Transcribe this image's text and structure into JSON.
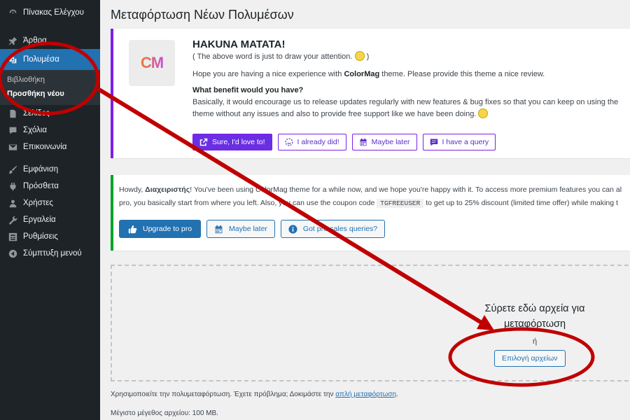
{
  "sidebar": {
    "items": [
      {
        "label": "Πίνακας Ελέγχου",
        "icon": "dashboard-icon"
      },
      {
        "label": "Άρθρα",
        "icon": "pin-icon"
      },
      {
        "label": "Πολυμέσα",
        "icon": "media-icon"
      },
      {
        "label": "Σελίδες",
        "icon": "page-icon"
      },
      {
        "label": "Σχόλια",
        "icon": "comment-icon"
      },
      {
        "label": "Επικοινωνία",
        "icon": "mail-icon"
      },
      {
        "label": "Εμφάνιση",
        "icon": "brush-icon"
      },
      {
        "label": "Πρόσθετα",
        "icon": "plugin-icon"
      },
      {
        "label": "Χρήστες",
        "icon": "users-icon"
      },
      {
        "label": "Εργαλεία",
        "icon": "wrench-icon"
      },
      {
        "label": "Ρυθμίσεις",
        "icon": "settings-icon"
      },
      {
        "label": "Σύμπτυξη μενού",
        "icon": "collapse-icon"
      }
    ],
    "submenu": {
      "library": "Βιβλιοθήκη",
      "add_new": "Προσθήκη νέου"
    }
  },
  "page_title": "Μεταφόρτωση Νέων Πολυμέσων",
  "notice1": {
    "logo_text": "CM",
    "title": "HAKUNA MATATA!",
    "subtitle": "( The above word is just to draw your attention.",
    "subtitle_end": ")",
    "line1_pre": "Hope you are having a nice experience with ",
    "line1_brand": "ColorMag",
    "line1_post": " theme. Please provide this theme a nice review.",
    "question": "What benefit would you have?",
    "body": "Basically, it would encourage us to release updates regularly with new features & bug fixes so that you can keep on using the theme without any issues and also to provide free support like we have been doing.",
    "buttons": [
      "Sure, I'd love to!",
      "I already did!",
      "Maybe later",
      "I have a query"
    ]
  },
  "notice2": {
    "line1_pre": "Howdy, ",
    "line1_user": "Διαχειριστής",
    "line1_post": "! You've been using ColorMag theme for a while now, and we hope you're happy with it. To access more premium features you can al",
    "line2_pre": "pro, you basically start from where you left. Also, you can use the coupon code ",
    "coupon": "TGFREEUSER",
    "line2_post": " to get up to 25% discount (limited time offer) while making t",
    "buttons": [
      "Upgrade to pro",
      "Maybe later",
      "Got pre-sales queries?"
    ]
  },
  "dropzone": {
    "text": "Σύρετε εδώ αρχεία για μεταφόρτωση",
    "or": "ή",
    "button": "Επιλογή αρχείων"
  },
  "info": {
    "line1": "Χρησιμοποιείτε την πολυμεταφόρτωση. Έχετε πρόβλημα; Δοκιμάστε την ",
    "line1_link": "απλή μεταφόρτωση",
    "line1_end": ".",
    "line2": "Μέγιστο μέγεθος αρχείου: 100 MB."
  },
  "colors": {
    "accent": "#2271b1",
    "annotation": "#c00000",
    "notice_purple": "#7e1ee8",
    "notice_green": "#00a32a"
  }
}
